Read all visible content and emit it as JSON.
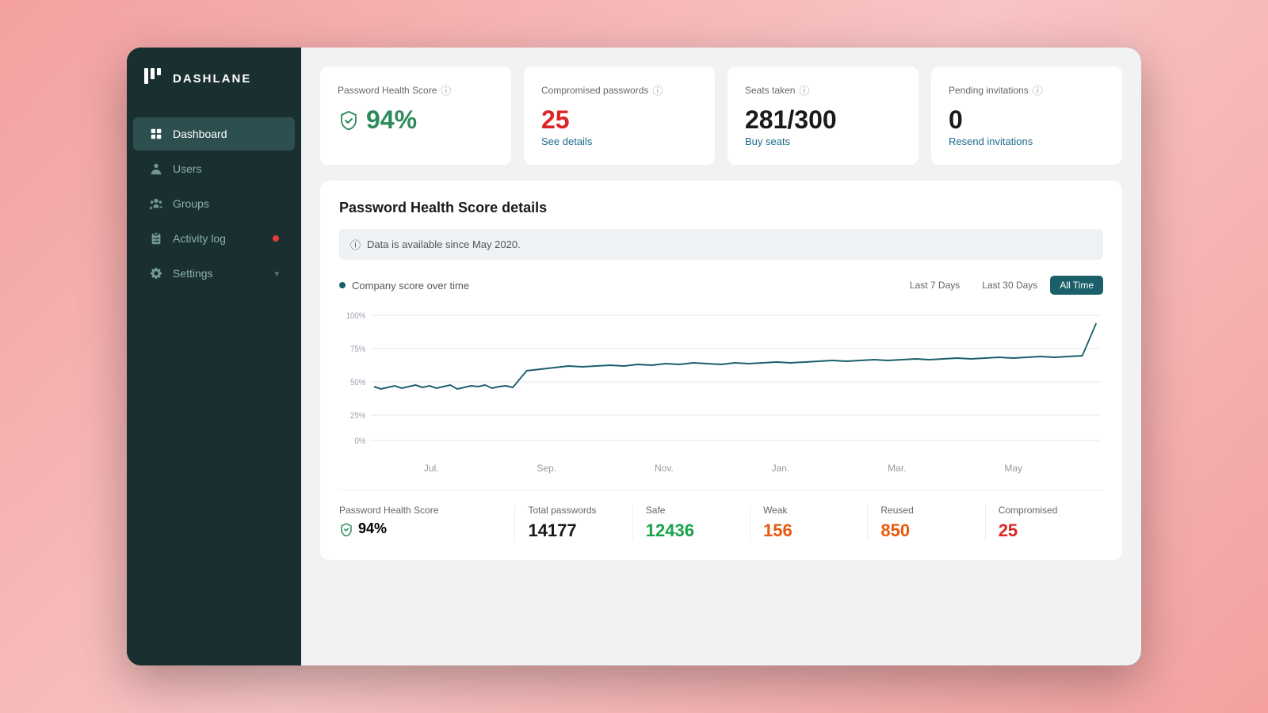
{
  "app": {
    "name": "DASHLANE"
  },
  "sidebar": {
    "items": [
      {
        "id": "dashboard",
        "label": "Dashboard",
        "icon": "dashboard-icon",
        "active": true,
        "badge": false
      },
      {
        "id": "users",
        "label": "Users",
        "icon": "users-icon",
        "active": false,
        "badge": false
      },
      {
        "id": "groups",
        "label": "Groups",
        "icon": "groups-icon",
        "active": false,
        "badge": false
      },
      {
        "id": "activity-log",
        "label": "Activity log",
        "icon": "activity-icon",
        "active": false,
        "badge": true
      },
      {
        "id": "settings",
        "label": "Settings",
        "icon": "settings-icon",
        "active": false,
        "badge": false,
        "hasChevron": true
      }
    ]
  },
  "stats": {
    "password_health_score": {
      "label": "Password Health Score",
      "value": "94%",
      "link": null
    },
    "compromised_passwords": {
      "label": "Compromised passwords",
      "value": "25",
      "link": "See details"
    },
    "seats_taken": {
      "label": "Seats taken",
      "value": "281/300",
      "link": "Buy seats"
    },
    "pending_invitations": {
      "label": "Pending invitations",
      "value": "0",
      "link": "Resend invitations"
    }
  },
  "chart": {
    "title": "Password Health Score details",
    "info_banner": "Data is available since May 2020.",
    "legend": "Company score over time",
    "time_filters": [
      "Last 7 Days",
      "Last 30 Days",
      "All Time"
    ],
    "active_filter": "All Time",
    "x_labels": [
      "Jul.",
      "Sep.",
      "Nov.",
      "Jan.",
      "Mar.",
      "May"
    ],
    "y_labels": [
      "100%",
      "75%",
      "50%",
      "25%",
      "0%"
    ]
  },
  "footer_stats": {
    "label": "Password Health Score",
    "score": "94%",
    "total_passwords": {
      "label": "Total passwords",
      "value": "14177"
    },
    "safe": {
      "label": "Safe",
      "value": "12436"
    },
    "weak": {
      "label": "Weak",
      "value": "156"
    },
    "reused": {
      "label": "Reused",
      "value": "850"
    },
    "compromised": {
      "label": "Compromised",
      "value": "25"
    }
  }
}
